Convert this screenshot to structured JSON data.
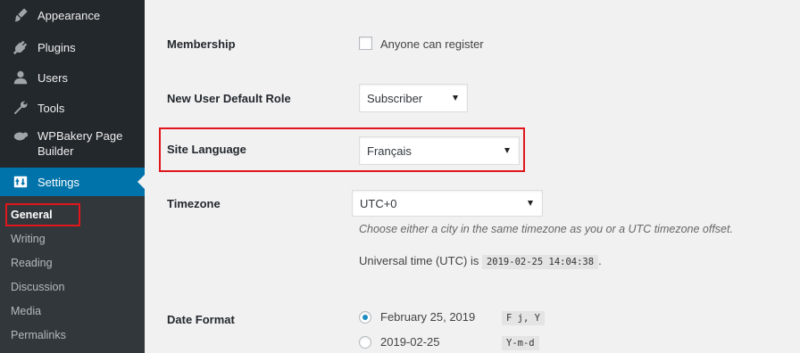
{
  "sidebar": {
    "items": [
      {
        "label": "Appearance",
        "icon": "paintbrush-icon"
      },
      {
        "label": "Plugins",
        "icon": "plug-icon"
      },
      {
        "label": "Users",
        "icon": "user-icon"
      },
      {
        "label": "Tools",
        "icon": "wrench-icon"
      },
      {
        "label": "WPBakery Page Builder",
        "icon": "wpbakery-icon"
      },
      {
        "label": "Settings",
        "icon": "settings-icon"
      }
    ],
    "submenu": [
      "General",
      "Writing",
      "Reading",
      "Discussion",
      "Media",
      "Permalinks"
    ]
  },
  "settings": {
    "membership": {
      "label": "Membership",
      "checkbox_label": "Anyone can register"
    },
    "default_role": {
      "label": "New User Default Role",
      "value": "Subscriber"
    },
    "site_language": {
      "label": "Site Language",
      "value": "Français"
    },
    "timezone": {
      "label": "Timezone",
      "value": "UTC+0",
      "description": "Choose either a city in the same timezone as you or a UTC timezone offset.",
      "utc_prefix": "Universal time (UTC) is",
      "utc_time": "2019-02-25 14:04:38",
      "utc_suffix": "."
    },
    "date_format": {
      "label": "Date Format",
      "options": [
        {
          "label": "February 25, 2019",
          "code": "F j, Y"
        },
        {
          "label": "2019-02-25",
          "code": "Y-m-d"
        }
      ]
    }
  },
  "colors": {
    "sidebar": "#23282d",
    "active": "#0073aa",
    "highlight": "#e0161c"
  }
}
